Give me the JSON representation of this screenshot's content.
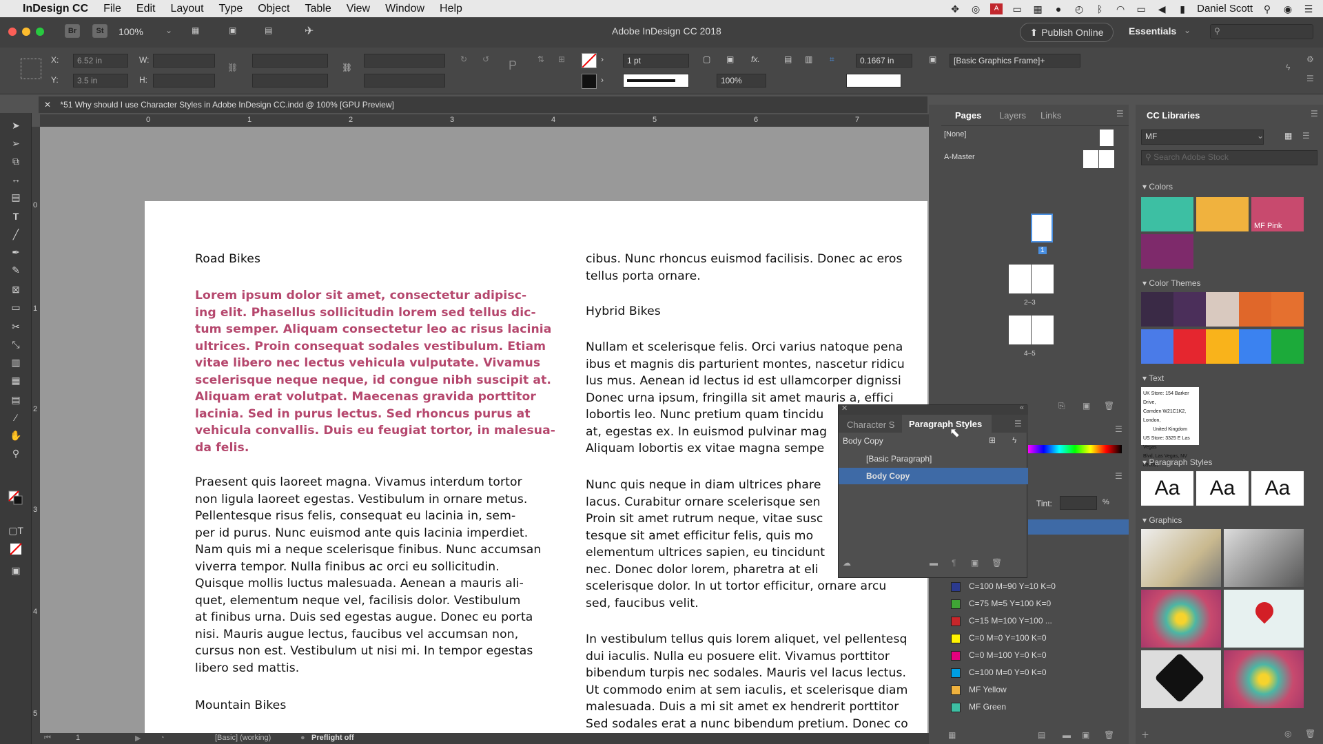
{
  "menubar": {
    "app": "InDesign CC",
    "items": [
      "File",
      "Edit",
      "Layout",
      "Type",
      "Object",
      "Table",
      "View",
      "Window",
      "Help"
    ],
    "user": "Daniel Scott"
  },
  "appbar": {
    "zoom": "100%",
    "title": "Adobe InDesign CC 2018",
    "publish": "Publish Online",
    "workspace": "Essentials",
    "br": "Br",
    "st": "St"
  },
  "control": {
    "x": "6.52 in",
    "y": "3.5 in",
    "x_label": "X:",
    "y_label": "Y:",
    "w_label": "W:",
    "h_label": "H:",
    "stroke": "1 pt",
    "opacity": "100%",
    "size": "0.1667 in",
    "style": "[Basic Graphics Frame]+"
  },
  "tab": {
    "title": "*51 Why should I use Character Styles in Adobe InDesign CC.indd @ 100% [GPU Preview]"
  },
  "ruler": {
    "marks": [
      "0",
      "1",
      "2",
      "3",
      "4",
      "5",
      "6",
      "7"
    ],
    "vmarks": [
      "0",
      "1",
      "2",
      "3",
      "4",
      "5"
    ]
  },
  "doc": {
    "h_road": "Road Bikes",
    "pink": [
      "Lorem ipsum dolor sit amet, consectetur adipisc-",
      "ing elit. Phasellus sollicitudin lorem sed tellus dic-",
      "tum semper. Aliquam consectetur leo ac risus lacinia",
      "ultrices. Proin consequat sodales vestibulum. Etiam",
      "vitae libero nec lectus vehicula vulputate. Vivamus",
      "scelerisque neque neque, id congue nibh suscipit at.",
      "Aliquam erat volutpat. Maecenas gravida porttitor",
      "lacinia. Sed in purus lectus. Sed rhoncus purus at",
      "vehicula convallis. Duis eu feugiat tortor, in malesua-",
      "da felis."
    ],
    "body1": [
      "Praesent quis laoreet magna. Vivamus interdum tortor",
      "non ligula laoreet egestas. Vestibulum in ornare metus.",
      "Pellentesque risus felis, consequat eu lacinia in, sem-",
      "per id purus. Nunc euismod ante quis lacinia imperdiet.",
      "Nam quis mi a neque scelerisque finibus. Nunc accumsan",
      "viverra tempor. Nulla finibus ac orci eu sollicitudin.",
      "Quisque mollis luctus malesuada. Aenean a mauris ali-",
      "quet, elementum neque vel, facilisis dolor. Vestibulum",
      "at finibus urna. Duis sed egestas augue. Donec eu porta",
      "nisi. Mauris augue lectus, faucibus vel accumsan non,",
      "cursus non est. Vestibulum ut nisi mi. In tempor egestas",
      "libero sed mattis."
    ],
    "h_mountain": "Mountain Bikes",
    "col2a": [
      "cibus. Nunc rhoncus euismod facilisis. Donec ac eros",
      "tellus porta ornare."
    ],
    "h_hybrid": "Hybrid Bikes",
    "col2b": [
      "Nullam et scelerisque felis. Orci varius natoque pena",
      "ibus et magnis dis parturient montes, nascetur ridicu",
      "lus mus. Aenean id lectus id est ullamcorper dignissi",
      "Donec urna ipsum, fringilla sit amet mauris a, effici",
      "lobortis leo. Nunc pretium quam tincidu",
      "at, egestas ex. In euismod pulvinar mag",
      "Aliquam lobortis ex vitae magna sempe"
    ],
    "col2c": [
      "Nunc quis neque in diam ultrices phare",
      "lacus. Curabitur ornare scelerisque sen",
      "Proin sit amet rutrum neque, vitae susc",
      "tesque sit amet efficitur felis, quis mo",
      "elementum ultrices sapien, eu tincidunt",
      "nec. Donec dolor lorem, pharetra at eli",
      "scelerisque dolor. In ut tortor efficitur, ornare arcu",
      "sed, faucibus velit."
    ],
    "col2d": [
      "In vestibulum tellus quis lorem aliquet, vel pellentesq",
      "dui iaculis. Nulla eu posuere elit. Vivamus porttitor",
      "bibendum turpis nec sodales. Mauris vel lacus lectus.",
      "Ut commodo enim at sem iaculis, et scelerisque diam",
      "malesuada. Duis a mi sit amet ex hendrerit porttitor",
      "Sed sodales erat a nunc bibendum pretium. Donec co"
    ]
  },
  "pages": {
    "tabs": [
      "Pages",
      "Layers",
      "Links"
    ],
    "none": "[None]",
    "master": "A-Master",
    "p1": "1",
    "p23": "2–3",
    "p45": "4–5"
  },
  "parstyles": {
    "tab1": "Character S",
    "tab2": "Paragraph Styles",
    "current": "Body Copy",
    "items": [
      "[Basic Paragraph]",
      "Body Copy"
    ]
  },
  "swatches": {
    "tint": "Tint:",
    "pct": "%",
    "items": [
      {
        "name": "C=100 M=90 Y=10 K=0",
        "color": "#2b3a8f"
      },
      {
        "name": "C=75 M=5 Y=100 K=0",
        "color": "#3fa535"
      },
      {
        "name": "C=15 M=100 Y=100 ...",
        "color": "#c8262a"
      },
      {
        "name": "C=0 M=0 Y=100 K=0",
        "color": "#fff200"
      },
      {
        "name": "C=0 M=100 Y=0 K=0",
        "color": "#e5007e"
      },
      {
        "name": "C=100 M=0 Y=0 K=0",
        "color": "#009fe3"
      },
      {
        "name": "MF Yellow",
        "color": "#f0b23e"
      },
      {
        "name": "MF Green",
        "color": "#3dbfa3"
      }
    ]
  },
  "libraries": {
    "title": "CC Libraries",
    "library": "MF",
    "search": "Search Adobe Stock",
    "colors_label": "Colors",
    "themes_label": "Color Themes",
    "text_label": "Text",
    "pstyles_label": "Paragraph Styles",
    "graphics_label": "Graphics",
    "mfpink": "MF Pink",
    "aa": "Aa",
    "address": [
      "UK Store: 154 Barker Drive,",
      "Camden W21C1K2, London,",
      "United Kingdom",
      "US Store: 3325 E Las Vegas",
      "Blvd, Las Vegas, NV 89109,"
    ]
  },
  "status": {
    "page": "1",
    "style": "[Basic] (working)",
    "preflight": "Preflight off"
  }
}
